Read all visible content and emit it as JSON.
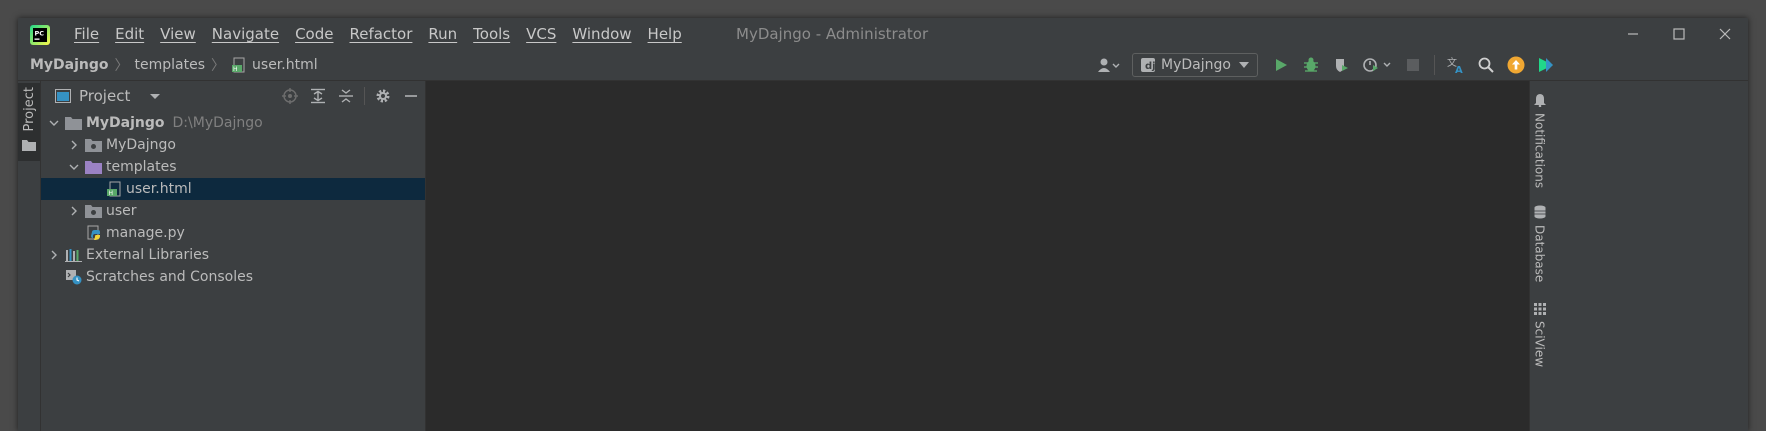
{
  "app": {
    "window_title": "MyDajngo - Administrator",
    "logo_text": "PC"
  },
  "menu": [
    "File",
    "Edit",
    "View",
    "Navigate",
    "Code",
    "Refactor",
    "Run",
    "Tools",
    "VCS",
    "Window",
    "Help"
  ],
  "breadcrumb": [
    "MyDajngo",
    "templates",
    "user.html"
  ],
  "toolbar": {
    "run_config": "MyDajngo"
  },
  "left_strip": {
    "project_tab": "Project"
  },
  "project_panel": {
    "title": "Project",
    "tree": {
      "root_name": "MyDajngo",
      "root_path": "D:\\MyDajngo",
      "mydajngo": "MyDajngo",
      "templates": "templates",
      "user_html": "user.html",
      "user": "user",
      "manage_py": "manage.py",
      "external_libraries": "External Libraries",
      "scratches": "Scratches and Consoles"
    }
  },
  "right_strip": {
    "notifications": "Notifications",
    "database": "Database",
    "sciview": "SciView"
  },
  "colors": {
    "accent_green": "#59a869",
    "selection": "#0d293e",
    "update_orange": "#f0a732",
    "folder": "#8f9297",
    "templates_folder": "#9b82c4"
  }
}
